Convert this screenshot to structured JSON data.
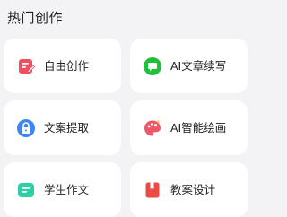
{
  "section": {
    "title": "热门创作"
  },
  "cards": [
    {
      "label": "自由创作",
      "icon": "pencil-note-icon",
      "color": "#ef4f5f"
    },
    {
      "label": "AI文章续写",
      "icon": "chat-bubble-icon",
      "color": "#21c03a"
    },
    {
      "label": "文案提取",
      "icon": "lock-icon",
      "color": "#3f86f4"
    },
    {
      "label": "AI智能绘画",
      "icon": "palette-icon",
      "color": "#f0576b"
    },
    {
      "label": "学生作文",
      "icon": "chat-lines-icon",
      "color": "#2fcfa5"
    },
    {
      "label": "教案设计",
      "icon": "bookmark-book-icon",
      "color": "#e94b45"
    }
  ]
}
